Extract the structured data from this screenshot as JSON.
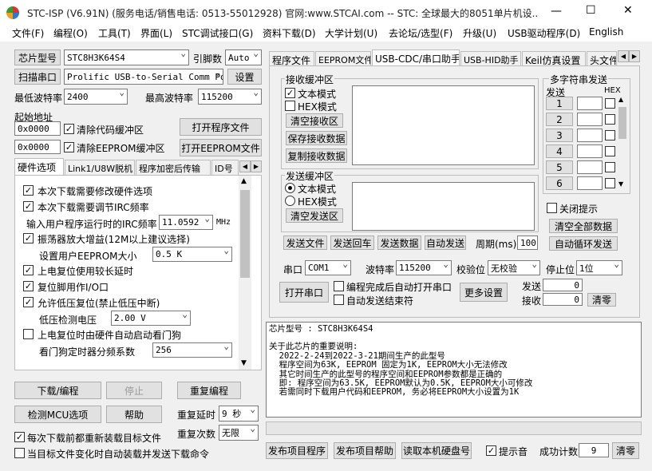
{
  "window": {
    "title": "STC-ISP (V6.91N) (服务电话/销售电话: 0513-55012928) 官网:www.STCAI.com  -- STC: 全球最大的8051单片机设...",
    "min": "—",
    "max": "☐",
    "close": "✕"
  },
  "menu": [
    "文件(F)",
    "编程(O)",
    "工具(T)",
    "界面(L)",
    "STC调试接口(G)",
    "资料下载(D)",
    "大学计划(U)",
    "去论坛/选型(F)",
    "升级(U)",
    "USB驱动程序(D)",
    "English"
  ],
  "left": {
    "chip_type_btn": "芯片型号",
    "chip_type_val": "STC8H3K64S4",
    "pin_label": "引脚数",
    "pin_val": "Auto",
    "scan_btn": "扫描串口",
    "port_val": "Prolific USB-to-Serial Comm Po",
    "settings_btn": "设置",
    "min_baud_label": "最低波特率",
    "min_baud_val": "2400",
    "max_baud_label": "最高波特率",
    "max_baud_val": "115200",
    "start_addr_label": "起始地址",
    "addr1": "0x0000",
    "clear_code": "清除代码缓冲区",
    "open_prog": "打开程序文件",
    "addr2": "0x0000",
    "clear_eeprom": "清除EEPROM缓冲区",
    "open_eeprom": "打开EEPROM文件",
    "tabs": [
      "硬件选项",
      "Link1/U8W脱机",
      "程序加密后传输",
      "ID号"
    ],
    "opts": {
      "o1": "本次下载需要修改硬件选项",
      "o2": "本次下载需要调节IRC频率",
      "irc_label": "输入用户程序运行时的IRC频率",
      "irc_val": "11.0592",
      "irc_unit": "MHz",
      "o3": "振荡器放大增益(12M以上建议选择)",
      "eeprom_label": "设置用户EEPROM大小",
      "eeprom_val": "0.5 K",
      "o4": "上电复位使用较长延时",
      "o5": "复位脚用作I/O口",
      "o6": "允许低压复位(禁止低压中断)",
      "lv_label": "低压检测电压",
      "lv_val": "2.00 V",
      "o7": "上电复位时由硬件自动启动看门狗",
      "wdt_label": "看门狗定时器分频系数",
      "wdt_val": "256"
    },
    "download_btn": "下载/编程",
    "stop_btn": "停止",
    "reprogram_btn": "重复编程",
    "check_btn": "检测MCU选项",
    "help_btn": "帮助",
    "repeat_delay_label": "重复延时",
    "repeat_delay_val": "9 秒",
    "reload_cb": "每次下载前都重新装载目标文件",
    "repeat_count_label": "重复次数",
    "repeat_count_val": "无限",
    "auto_cb": "当目标文件变化时自动装载并发送下载命令"
  },
  "right": {
    "tabs": [
      "程序文件",
      "EEPROM文件",
      "USB-CDC/串口助手",
      "USB-HID助手",
      "Keil仿真设置",
      "头文件"
    ],
    "recv_title": "接收缓冲区",
    "text_mode": "文本模式",
    "hex_mode": "HEX模式",
    "clear_recv": "清空接收区",
    "save_recv": "保存接收数据",
    "copy_recv": "复制接收数据",
    "send_title": "发送缓冲区",
    "send_text": "文本模式",
    "send_hex": "HEX模式",
    "clear_send": "清空发送区",
    "multi_title": "多字符串发送",
    "multi_send": "发送",
    "multi_hex": "HEX",
    "multi_rows": [
      "1",
      "2",
      "3",
      "4",
      "5",
      "6"
    ],
    "close_tip": "关闭提示",
    "clear_all": "清空全部数据",
    "auto_loop": "自动循环发送",
    "send_file": "发送文件",
    "send_return": "发送回车",
    "send_data": "发送数据",
    "auto_send": "自动发送",
    "period_label": "周期(ms)",
    "period_val": "100",
    "port_label": "串口",
    "port_val": "COM1",
    "baud_label": "波特率",
    "baud_val": "115200",
    "parity_label": "校验位",
    "parity_val": "无校验",
    "stop_label": "停止位",
    "stop_val": "1位",
    "open_port": "打开串口",
    "auto_open": "编程完成后自动打开串口",
    "auto_end": "自动发送结束符",
    "more": "更多设置",
    "send_label": "发送",
    "send_count": "0",
    "recv_label": "接收",
    "recv_count": "0",
    "clear_zero": "清零",
    "info_lines": [
      "芯片型号 : STC8H3K64S4",
      "",
      "关于此芯片的重要说明:",
      "  2022-2-24到2022-3-21期间生产的此型号",
      "  程序空间为63K, EEPROM 固定为1K, EEPROM大小无法修改",
      "  其它时间生产的此型号的程序空间和EEPROM参数都是正确的",
      "  即: 程序空间为63.5K, EEPROM默认为0.5K, EEPROM大小可修改",
      "  若需同时下载用户代码和EEPROM, 务必将EEPROM大小设置为1K"
    ],
    "publish_prog": "发布项目程序",
    "publish_help": "发布项目帮助",
    "read_disk": "读取本机硬盘号",
    "sound_cb": "提示音",
    "success_label": "成功计数",
    "success_val": "9",
    "clear_btn": "清零"
  },
  "colors": {
    "titlebar": "#ffffff",
    "bg": "#f0f0f0",
    "accent": "#0060c0"
  }
}
